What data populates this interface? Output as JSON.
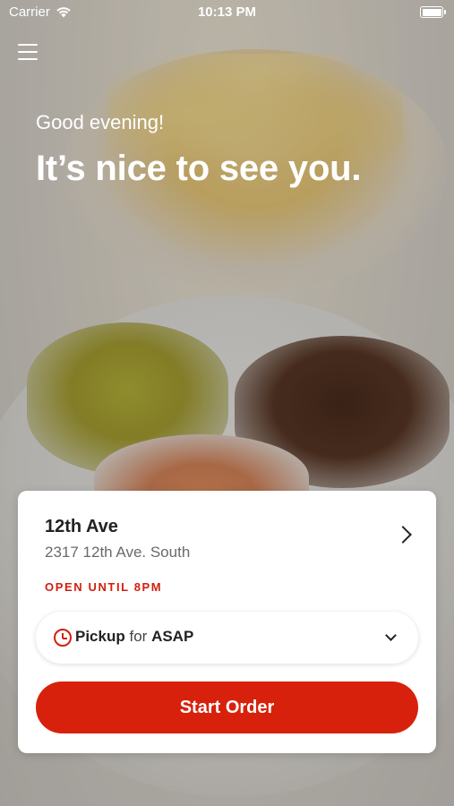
{
  "status_bar": {
    "carrier": "Carrier",
    "time": "10:13 PM",
    "battery_level": 1.0
  },
  "header": {
    "menu_icon": "hamburger-menu-icon",
    "greeting": "Good evening!",
    "headline": "It’s nice to see you."
  },
  "location_card": {
    "name": "12th Ave",
    "address": "2317 12th Ave. South",
    "hours": "OPEN UNTIL 8PM",
    "pickup": {
      "method": "Pickup",
      "connector": "for",
      "time": "ASAP"
    },
    "start_order_label": "Start Order"
  },
  "colors": {
    "accent": "#d8210c",
    "text_primary": "#222222",
    "text_secondary": "#6a6a6a",
    "card_background": "#ffffff"
  }
}
